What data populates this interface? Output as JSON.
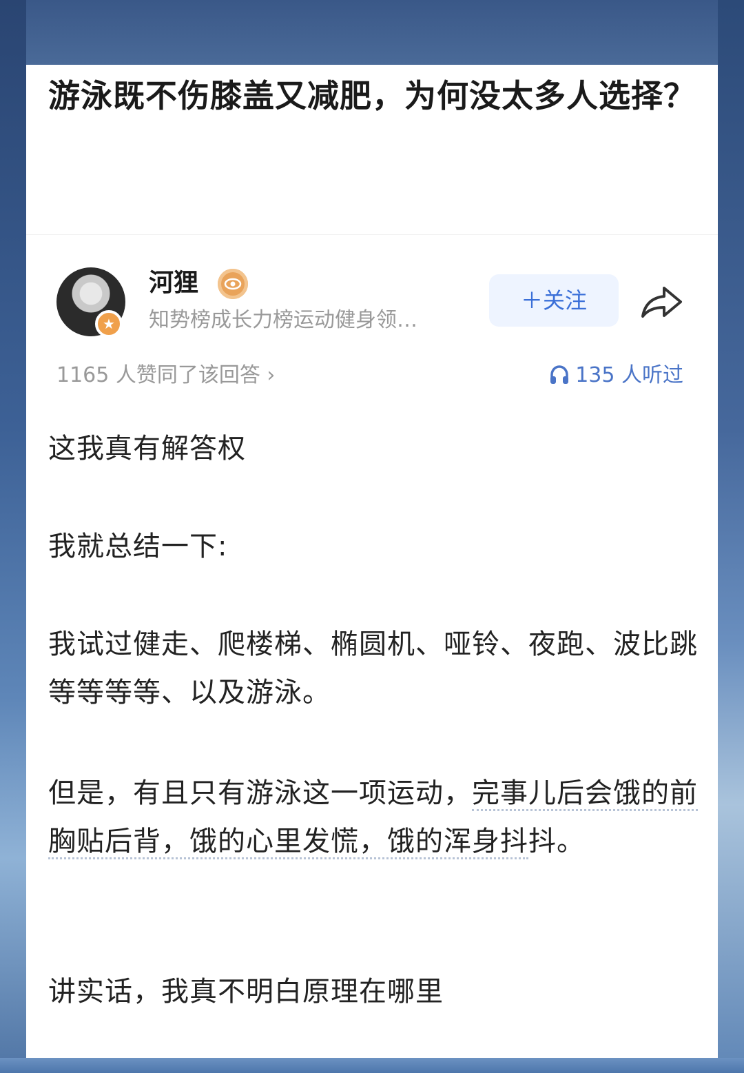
{
  "question": {
    "title": "游泳既不伤膝盖又减肥，为何没太多人选择？"
  },
  "answer": {
    "author_name": "河狸",
    "author_desc": "知势榜成长力榜运动健身领…",
    "follow_label": "＋关注",
    "likes_text": "1165 人赞同了该回答 ›",
    "listens_text": "135 人听过",
    "paragraphs": [
      "这我真有解答权",
      "我就总结一下:",
      "我试过健走、爬楼梯、椭圆机、哑铃、夜跑、波比跳等等等等、以及游泳。",
      "但是，有且只有游泳这一项运动，",
      "完事儿后会饿的前胸贴后背，饿的心里发慌，饿的浑身抖",
      "抖。",
      "讲实话，我真不明白原理在哪里"
    ]
  },
  "icons": {
    "share": "share-arrow-icon",
    "headphone": "headphone-icon",
    "badge": "star-badge-icon",
    "medal": "eye-medal-icon"
  },
  "colors": {
    "accent": "#3a6fd8",
    "muted": "#999999"
  }
}
